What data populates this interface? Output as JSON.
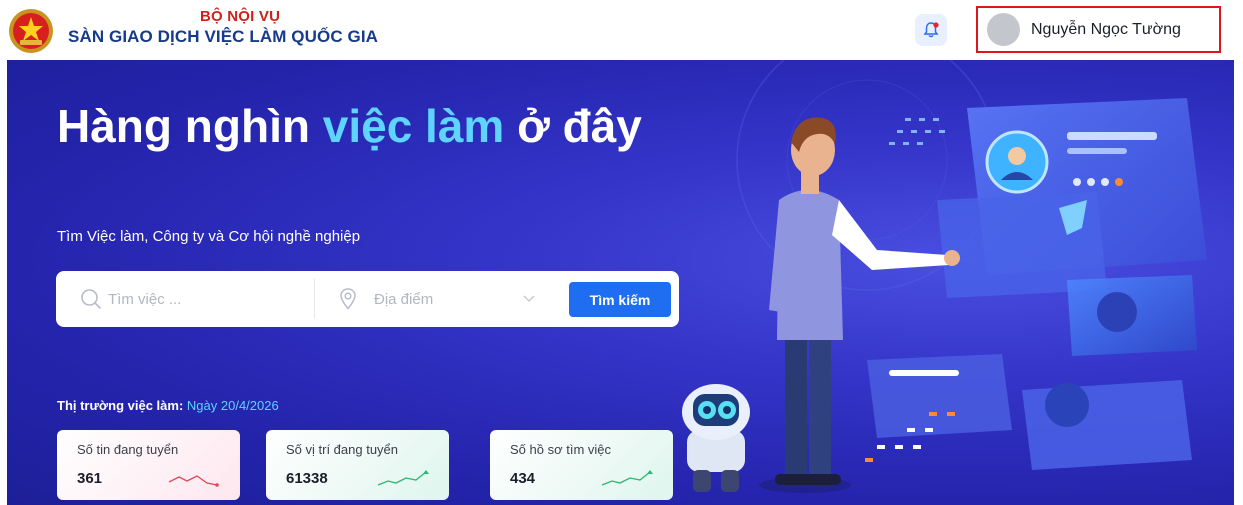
{
  "header": {
    "ministry": "BỘ NỘI VỤ",
    "site_name": "SÀN GIAO DỊCH VIỆC LÀM QUỐC GIA",
    "notification_icon": "bell-icon",
    "user_name": "Nguyễn Ngọc Tường"
  },
  "hero": {
    "title_part1": "Hàng nghìn ",
    "title_highlight": "việc làm",
    "title_part2": " ở đây",
    "subtitle": "Tìm Việc làm, Công ty và Cơ hội nghề nghiệp",
    "search": {
      "job_placeholder": "Tìm việc ...",
      "location_placeholder": "Địa điểm",
      "button_label": "Tìm kiếm"
    },
    "market_label": "Thị trường việc làm:",
    "market_date": "Ngày 20/4/2026",
    "stats": [
      {
        "label": "Số tin đang tuyển",
        "value": "361",
        "trend": "down"
      },
      {
        "label": "Số vị trí đang tuyển",
        "value": "61338",
        "trend": "up"
      },
      {
        "label": "Số hồ sơ tìm việc",
        "value": "434",
        "trend": "up"
      }
    ]
  },
  "colors": {
    "hero_background": "#2a2ab8",
    "highlight": "#5fd4ff",
    "button": "#1f6ef2",
    "trend_down": "#e0455c",
    "trend_up": "#2bb673",
    "user_box_border": "#e0141b"
  }
}
